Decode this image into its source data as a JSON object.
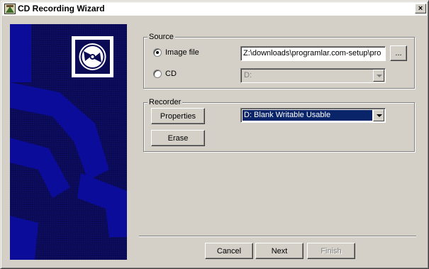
{
  "window": {
    "title": "CD Recording Wizard",
    "close_glyph": "×"
  },
  "source": {
    "legend": "Source",
    "image_file_label": "Image file",
    "image_file_value": "Z:\\downloads\\programlar.com-setup\\pro",
    "browse_label": "...",
    "cd_label": "CD",
    "cd_drive_value": "D:"
  },
  "recorder": {
    "legend": "Recorder",
    "properties_label": "Properties",
    "erase_label": "Erase",
    "drive_value": "D: Blank Writable Usable"
  },
  "footer": {
    "cancel_label": "Cancel",
    "next_label": "Next",
    "finish_label": "Finish"
  },
  "colors": {
    "panel_blue": "#0a0a55",
    "anchor_blue": "#0c0c9a",
    "selection": "#0a246a"
  },
  "icons": {
    "title": "cd-wizard-icon",
    "logo": "cd-disc-icon"
  }
}
